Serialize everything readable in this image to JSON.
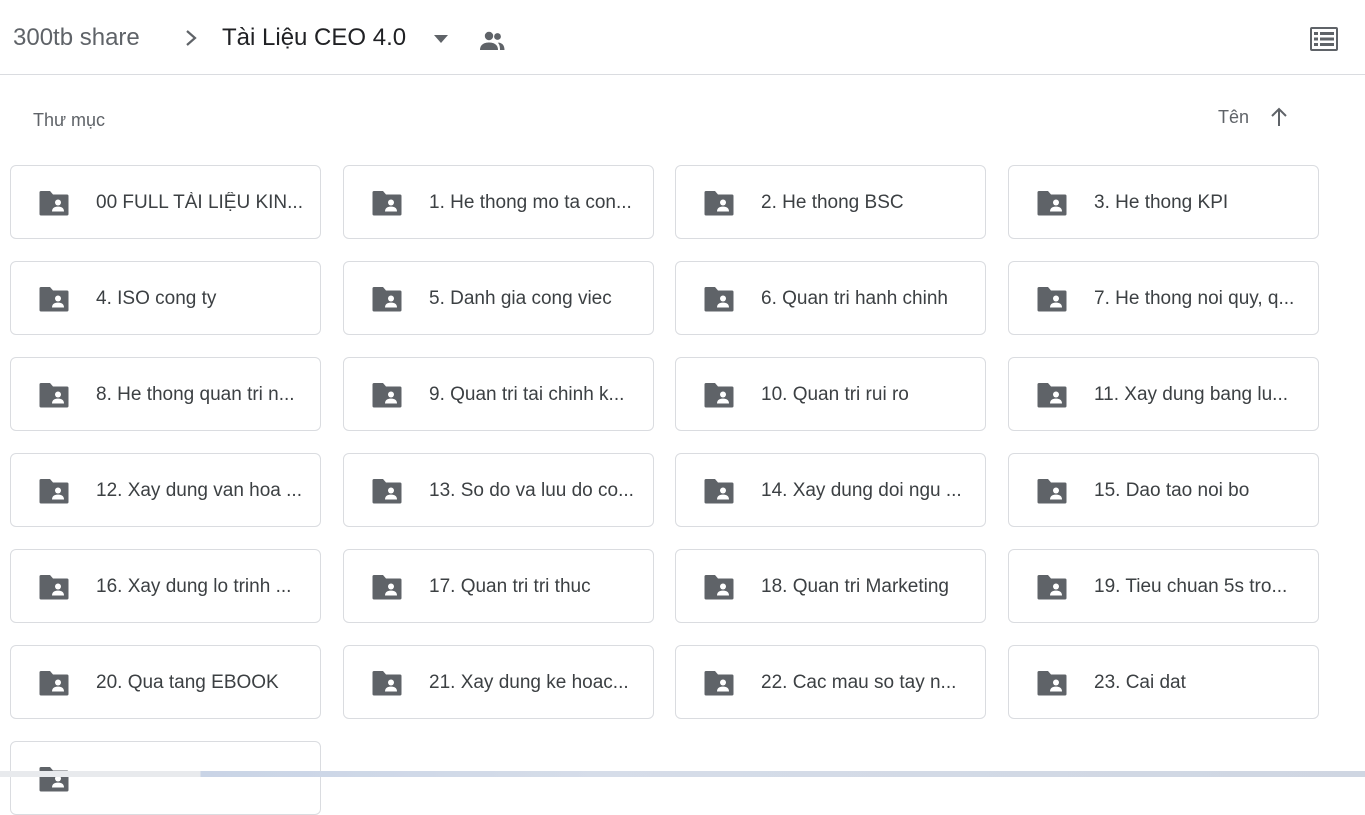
{
  "breadcrumb": {
    "root": "300tb share",
    "current": "Tài Liệu CEO 4.0"
  },
  "icons": {
    "separator": "chevron-right-icon",
    "dropdown": "caret-down-icon",
    "shared": "shared-people-icon",
    "view": "list-view-icon",
    "sort": "arrow-up-icon",
    "folder": "shared-folder-icon"
  },
  "colors": {
    "folder_icon": "#5f6368",
    "border": "#dadce0",
    "text": "#3c4043"
  },
  "section": {
    "label": "Thư mục"
  },
  "sort": {
    "label": "Tên"
  },
  "folders": [
    {
      "name": "00 FULL TÀI LIỆU KIN..."
    },
    {
      "name": "1. He thong mo ta con..."
    },
    {
      "name": "2. He thong BSC"
    },
    {
      "name": "3. He thong KPI"
    },
    {
      "name": "4. ISO cong ty"
    },
    {
      "name": "5. Danh gia cong viec"
    },
    {
      "name": "6. Quan tri hanh chinh"
    },
    {
      "name": "7. He thong noi quy, q..."
    },
    {
      "name": "8. He thong quan tri n..."
    },
    {
      "name": "9. Quan tri tai chinh k..."
    },
    {
      "name": "10. Quan tri rui ro"
    },
    {
      "name": "11. Xay dung bang lu..."
    },
    {
      "name": "12. Xay dung van hoa ..."
    },
    {
      "name": "13. So do va luu do co..."
    },
    {
      "name": "14. Xay dung doi ngu ..."
    },
    {
      "name": "15. Dao tao noi bo"
    },
    {
      "name": "16. Xay dung lo trinh ..."
    },
    {
      "name": "17. Quan tri tri thuc"
    },
    {
      "name": "18. Quan tri Marketing"
    },
    {
      "name": "19. Tieu chuan 5s tro..."
    },
    {
      "name": "20. Qua tang EBOOK"
    },
    {
      "name": "21. Xay dung ke hoac..."
    },
    {
      "name": "22. Cac mau so tay n..."
    },
    {
      "name": "23. Cai dat"
    },
    {
      "name": ""
    }
  ]
}
